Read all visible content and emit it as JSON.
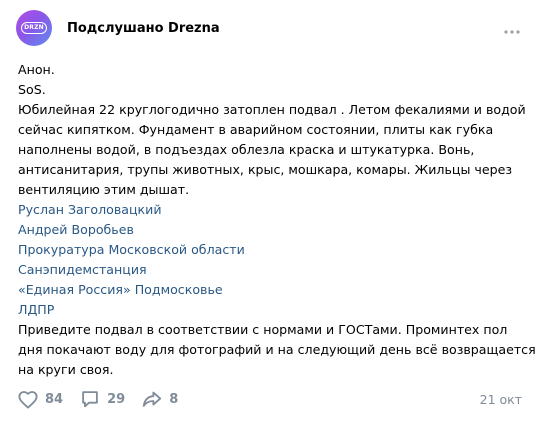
{
  "post": {
    "group": {
      "name": "Подслушано Drezna",
      "avatar_text": "DRZN"
    },
    "text": {
      "line1": "Анон.",
      "line2": "SoS.",
      "paragraph": [
        "Юбилейная 22 круглогодично затоплен подвал . Летом фекалиями и водой",
        "сейчас кипятком. Фундамент в аварийном состоянии, плиты как губка",
        "наполнены водой, в подъездах облезла краска и штукатурка. Вонь,",
        "антисанитария, трупы животных, крыс, мошкара, комары. Жильцы через",
        "вентиляцию этим дышат."
      ],
      "mentions": [
        "Руслан Заголовацкий",
        "Андрей Воробьев",
        "Прокуратура Московской области",
        "Санэпидемстанция",
        "«Единая Россия» Подмосковье",
        "ЛДПР"
      ],
      "closing": [
        "Приведите подвал в соответствии с нормами и ГОСТами. Проминтех пол",
        "дня покачают воду для фотографий и на следующий день всё возвращается",
        "на круги своя."
      ]
    },
    "footer": {
      "likes": "84",
      "comments": "29",
      "shares": "8",
      "date": "21 окт"
    }
  },
  "colors": {
    "link": "#2a5885",
    "secondary": "#818c99",
    "text": "#000000"
  },
  "icons": {
    "more": "more-horizontal-icon",
    "like": "heart-icon",
    "comment": "comment-icon",
    "share": "share-icon"
  }
}
